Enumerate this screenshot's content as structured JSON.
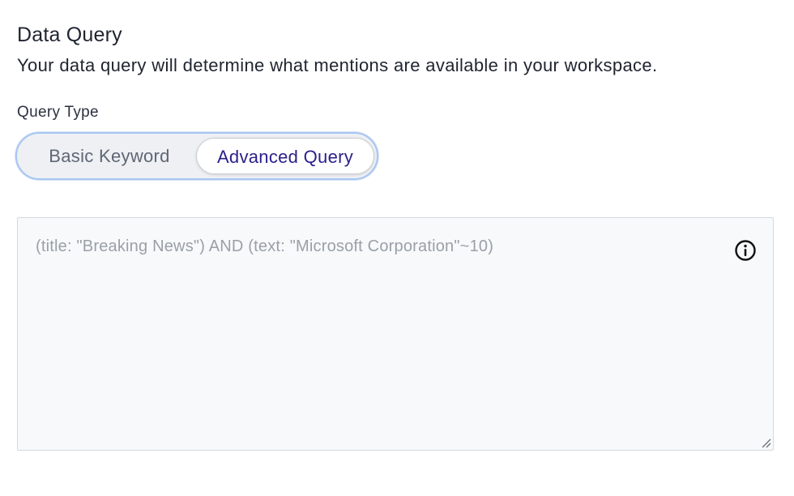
{
  "section": {
    "title": "Data Query",
    "description": "Your data query will determine what mentions are available in your workspace."
  },
  "query_type": {
    "label": "Query Type",
    "options": [
      {
        "label": "Basic Keyword",
        "selected": false
      },
      {
        "label": "Advanced Query",
        "selected": true
      }
    ]
  },
  "query": {
    "value": "",
    "placeholder": "(title: \"Breaking News\") AND (text: \"Microsoft Corporation\"~10)",
    "info_icon": "info-circle-icon"
  },
  "colors": {
    "selected_text": "#2a1f8a",
    "toggle_border": "#a8c6f2",
    "input_background": "#f7f9fb"
  }
}
